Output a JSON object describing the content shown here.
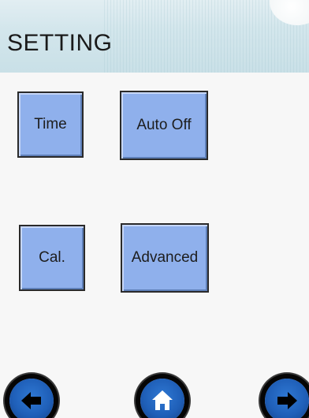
{
  "header": {
    "title": "SETTING"
  },
  "buttons": {
    "time": "Time",
    "auto_off": "Auto Off",
    "cal": "Cal.",
    "advanced": "Advanced"
  },
  "nav": {
    "back_icon": "arrow-left-icon",
    "home_icon": "home-icon",
    "next_icon": "arrow-right-icon"
  },
  "colors": {
    "button_fill": "#8fb0ec",
    "header_bg": "#d3e6ec",
    "nav_blue": "#1f5fb8"
  }
}
